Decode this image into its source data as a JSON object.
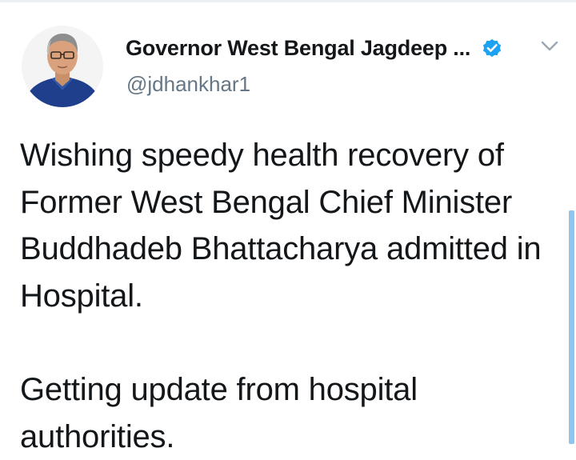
{
  "author": {
    "display_name": "Governor West Bengal Jagdeep ...",
    "handle": "@jdhankhar1",
    "verified": true,
    "avatar_icon": "profile-photo",
    "verified_icon": "verified-badge-icon",
    "menu_icon": "chevron-down-icon"
  },
  "tweet": {
    "paragraph_1": "Wishing speedy health recovery of Former West Bengal Chief Minister Buddhadeb Bhattacharya admitted in Hospital.",
    "paragraph_2": "Getting update from hospital authorities."
  },
  "colors": {
    "verified_blue": "#1da1f2",
    "handle_gray": "#657786",
    "text_dark": "#14171a",
    "scrollbar": "#8fc6f0"
  }
}
